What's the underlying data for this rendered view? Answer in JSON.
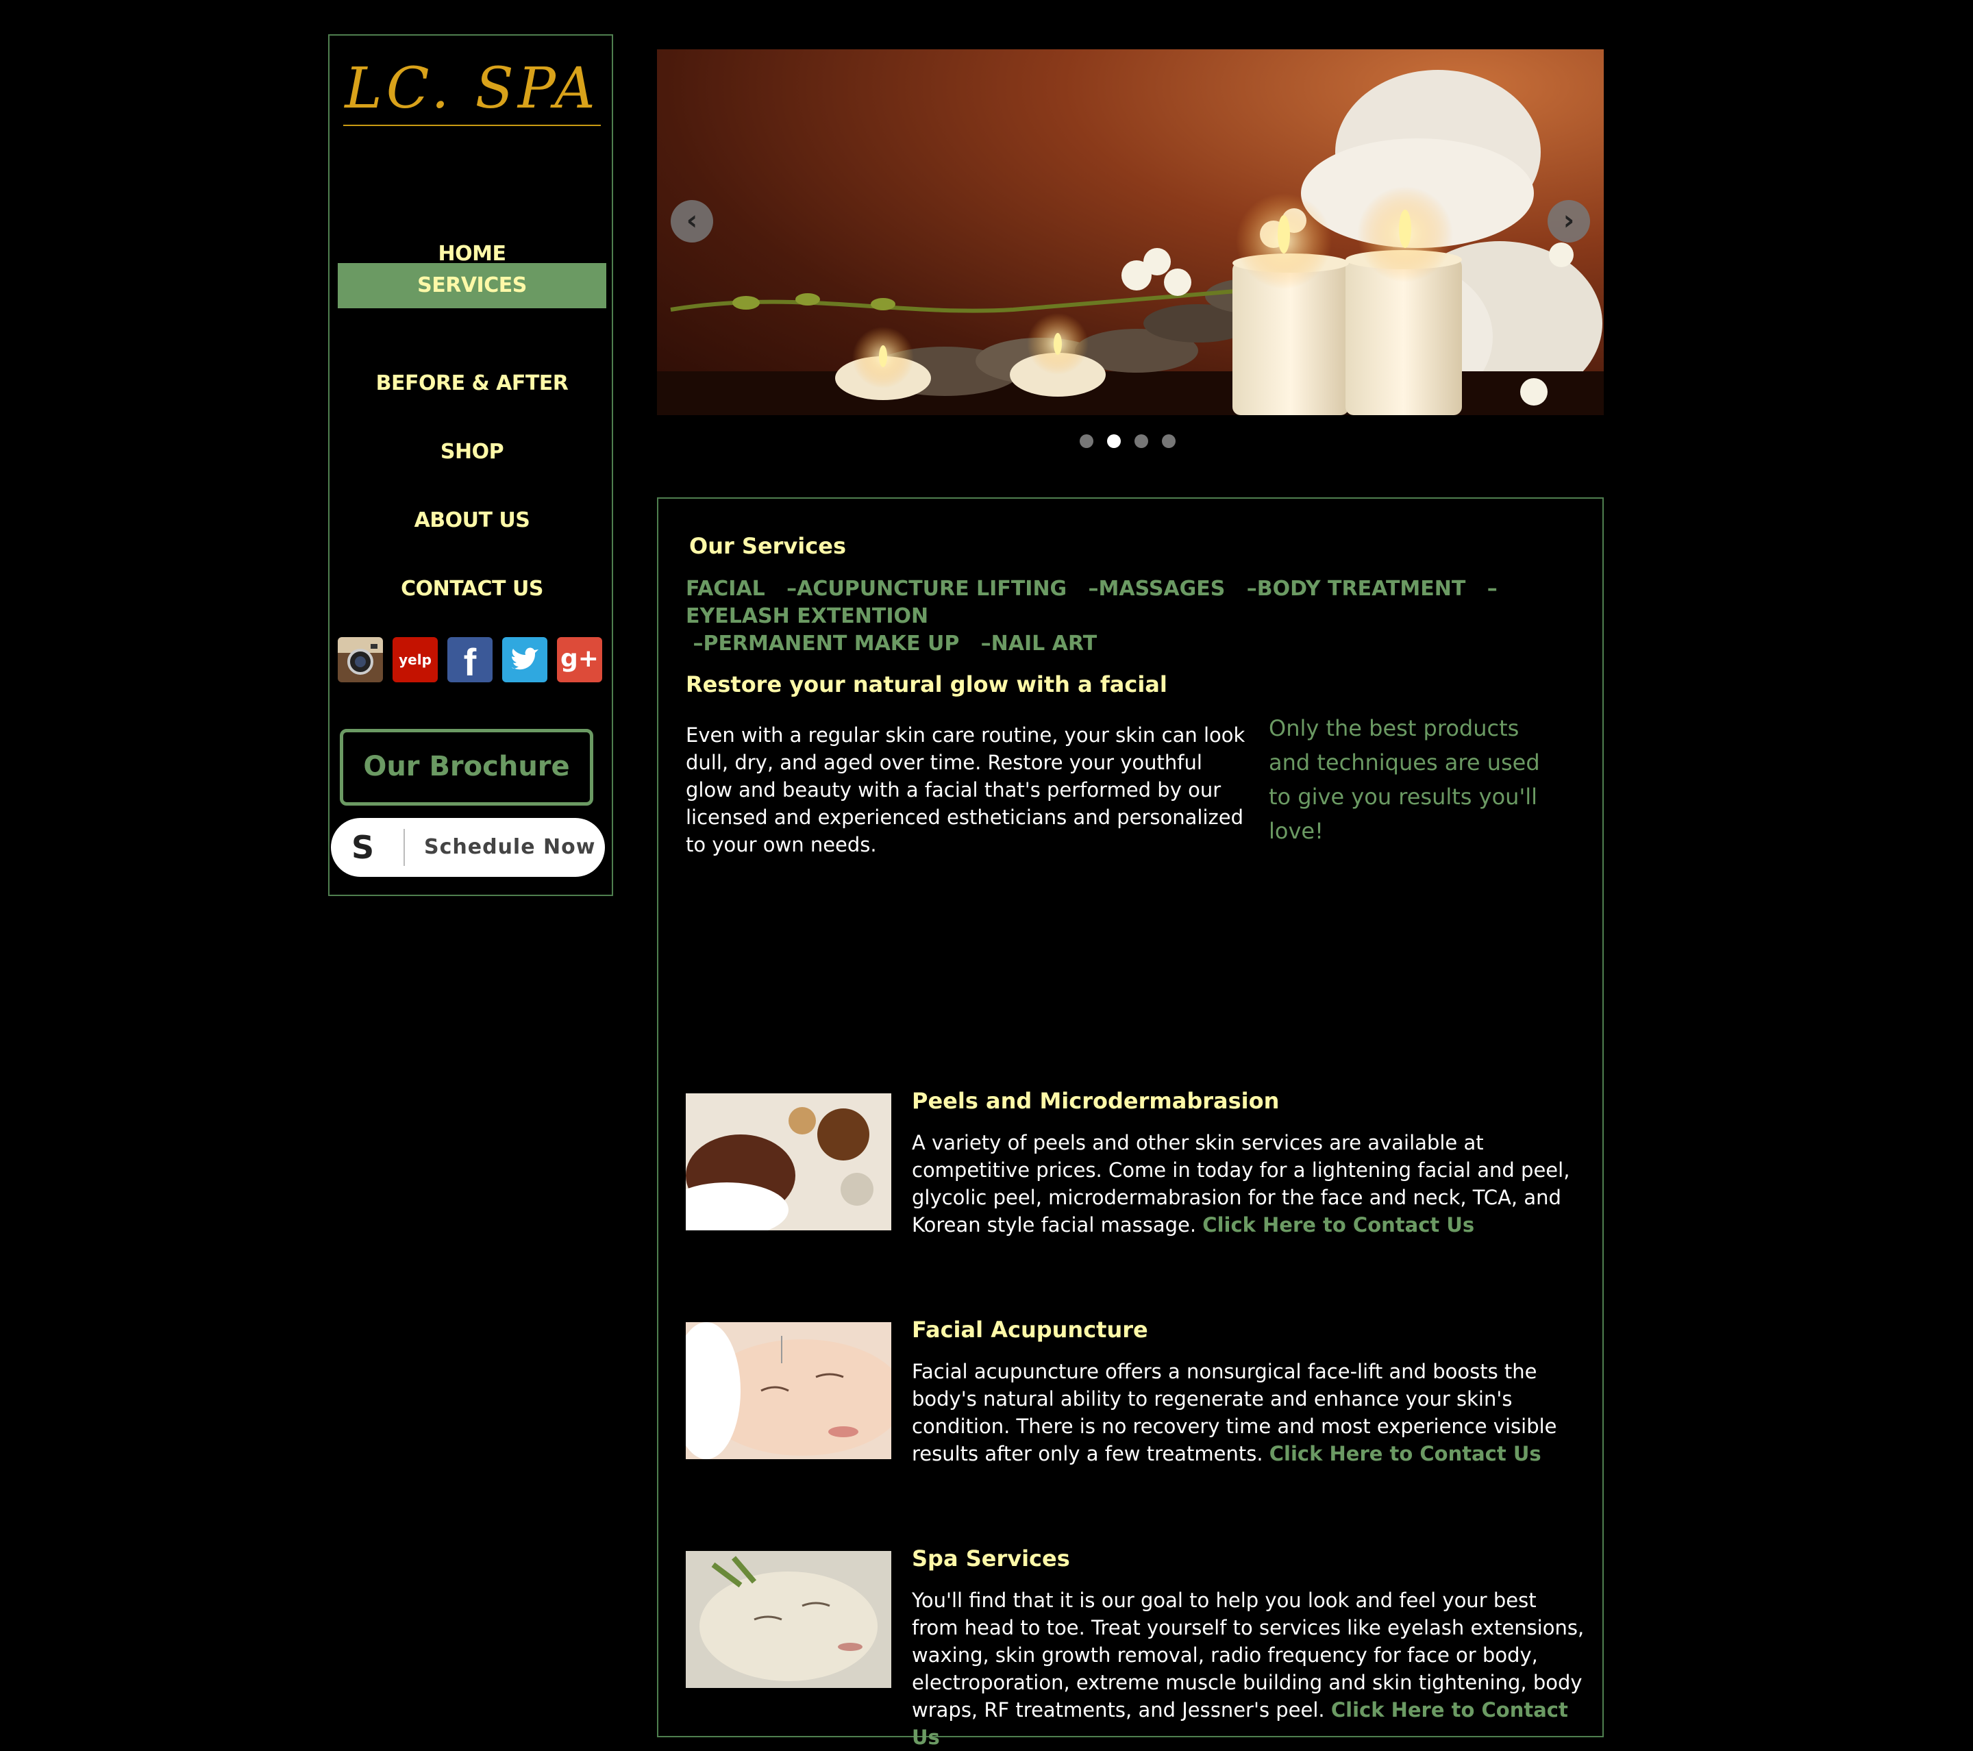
{
  "brand": {
    "logo_text": "LC. SPA"
  },
  "nav": [
    {
      "label": "HOME"
    },
    {
      "label": "SERVICES",
      "active": true
    },
    {
      "label": "BEFORE & AFTER"
    },
    {
      "label": "SHOP"
    },
    {
      "label": "ABOUT US"
    },
    {
      "label": "CONTACT US"
    }
  ],
  "social": [
    {
      "name": "instagram-icon"
    },
    {
      "name": "yelp-icon",
      "text": "yelp"
    },
    {
      "name": "facebook-icon",
      "text": "f"
    },
    {
      "name": "twitter-icon"
    },
    {
      "name": "google-plus-icon",
      "text": "g+"
    }
  ],
  "sidebar": {
    "brochure_label": "Our Brochure",
    "schedule_label": "Schedule Now",
    "schedule_logo": "S"
  },
  "slider": {
    "prev_arrow": "‹",
    "next_arrow": "›",
    "slide_count": 4,
    "active_slide": 2
  },
  "services": {
    "title": "Our Services",
    "links": [
      "FACIAL",
      "ACUPUNCTURE LIFTING",
      "MASSAGES",
      "BODY TREATMENT",
      "EYELASH EXTENTION",
      "PERMANENT MAKE UP",
      "NAIL ART"
    ],
    "separator": "–",
    "facial_heading": "Restore your natural glow with a facial",
    "facial_body": "Even with a regular skin care routine, your skin can look dull, dry, and aged over time. Restore your youthful glow and beauty with a facial that's performed by our licensed and experienced estheticians and personalized to your own needs.",
    "quote": "Only the best products and techniques are used to give you results you'll love!",
    "items": [
      {
        "title": "Peels and Microdermabrasion",
        "body": "A variety of peels and other skin services are available at competitive prices. Come in today for a lightening facial and peel, glycolic peel, microdermabrasion for the face and neck, TCA, and Korean style facial massage. ",
        "cta": "Click Here to Contact Us"
      },
      {
        "title": "Facial Acupuncture",
        "body": "Facial acupuncture offers a nonsurgical face-lift and boosts the body's natural ability to regenerate and enhance your skin's condition. There is no recovery time and most experience visible results after only a few treatments. ",
        "cta": "Click Here to Contact Us"
      },
      {
        "title": "Spa Services",
        "body": "You'll find that it is our goal to help you look and feel your best from head to toe. Treat yourself to services like eyelash extensions, waxing, skin growth removal, radio frequency for face or body, electroporation, extreme muscle building and skin tightening, body wraps, RF treatments, and Jessner's peel. ",
        "cta": "Click Here to Contact Us"
      }
    ]
  },
  "colors": {
    "background": "#000000",
    "accent_green": "#6b9a63",
    "nav_yellow": "#fff9a8",
    "logo_gold": "#d9a21a",
    "border_green": "#4f7f4f"
  }
}
